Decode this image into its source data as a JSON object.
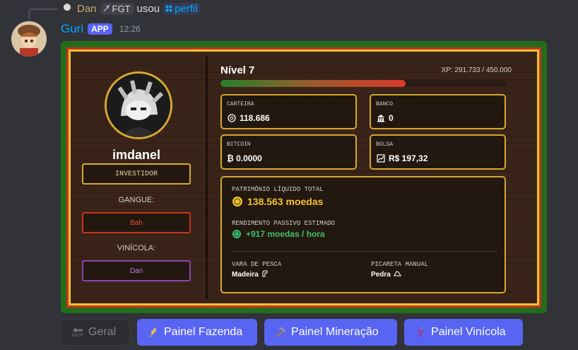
{
  "reply": {
    "user": "Dan",
    "tag": "FGT",
    "verb": "usou",
    "command": "perfil"
  },
  "message": {
    "author": "Guri",
    "badge": "APP",
    "time": "12:26"
  },
  "profile": {
    "username": "imdanel",
    "role": "INVESTIDOR",
    "gang_label": "GANGUE:",
    "gang_value": "Bah",
    "winery_label": "VINÍCOLA:",
    "winery_value": "Dan",
    "level": "Nível 7",
    "xp_text": "XP: 291.733 / 450.000",
    "xp_fraction": 0.648,
    "wallet_label": "CARTEIRA",
    "wallet_value": "118.686",
    "bank_label": "BANCO",
    "bank_value": "0",
    "bitcoin_label": "BITCOIN",
    "bitcoin_value": "₿ 0.0000",
    "stocks_label": "BOLSA",
    "stocks_value": "R$ 197,32",
    "networth_label": "PATRIMÔNIO LÍQUIDO TOTAL",
    "networth_value": "138.563 moedas",
    "passive_label": "RENDIMENTO PASSIVO ESTIMADO",
    "passive_value": "+917 moedas / hora",
    "rod_label": "VARA DE PESCA",
    "rod_value": "Madeira",
    "pick_label": "PICARETA MANUAL",
    "pick_value": "Pedra"
  },
  "buttons": {
    "back_label": "Geral",
    "back_icon_text": "BACK",
    "farm": "Painel Fazenda",
    "mining": "Painel Mineração",
    "winery": "Painel Vinícola"
  },
  "colors": {
    "gold": "#f1c232",
    "green": "#3ec16b",
    "blurple": "#5865f2",
    "gang": "#c8341e",
    "winery": "#8e44ad"
  }
}
